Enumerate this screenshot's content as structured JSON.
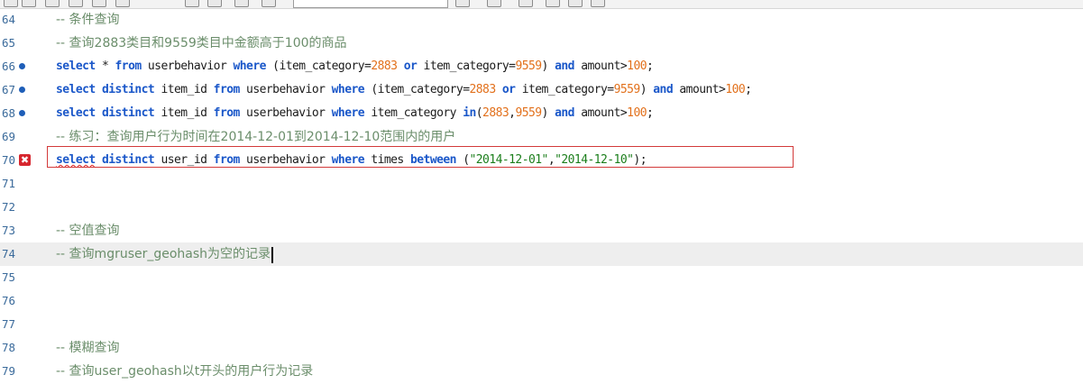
{
  "lines": [
    {
      "no": "64",
      "kind": "comment",
      "text": "-- 条件查询"
    },
    {
      "no": "65",
      "kind": "comment",
      "text": "-- 查询2883类目和9559类目中金额高于100的商品"
    },
    {
      "no": "66",
      "kind": "code",
      "marker": "dot",
      "tokens": [
        {
          "t": "kw",
          "v": "select"
        },
        {
          "t": "id",
          "v": " * "
        },
        {
          "t": "kw",
          "v": "from"
        },
        {
          "t": "id",
          "v": " userbehavior "
        },
        {
          "t": "kw",
          "v": "where"
        },
        {
          "t": "id",
          "v": " (item_category="
        },
        {
          "t": "num",
          "v": "2883"
        },
        {
          "t": "id",
          "v": " "
        },
        {
          "t": "kw",
          "v": "or"
        },
        {
          "t": "id",
          "v": " item_category="
        },
        {
          "t": "num",
          "v": "9559"
        },
        {
          "t": "id",
          "v": ") "
        },
        {
          "t": "kw",
          "v": "and"
        },
        {
          "t": "id",
          "v": " amount>"
        },
        {
          "t": "num",
          "v": "100"
        },
        {
          "t": "id",
          "v": ";"
        }
      ]
    },
    {
      "no": "67",
      "kind": "code",
      "marker": "dot",
      "tokens": [
        {
          "t": "kw",
          "v": "select"
        },
        {
          "t": "id",
          "v": " "
        },
        {
          "t": "kw",
          "v": "distinct"
        },
        {
          "t": "id",
          "v": " item_id "
        },
        {
          "t": "kw",
          "v": "from"
        },
        {
          "t": "id",
          "v": " userbehavior "
        },
        {
          "t": "kw",
          "v": "where"
        },
        {
          "t": "id",
          "v": " (item_category="
        },
        {
          "t": "num",
          "v": "2883"
        },
        {
          "t": "id",
          "v": " "
        },
        {
          "t": "kw",
          "v": "or"
        },
        {
          "t": "id",
          "v": " item_category="
        },
        {
          "t": "num",
          "v": "9559"
        },
        {
          "t": "id",
          "v": ") "
        },
        {
          "t": "kw",
          "v": "and"
        },
        {
          "t": "id",
          "v": " amount>"
        },
        {
          "t": "num",
          "v": "100"
        },
        {
          "t": "id",
          "v": ";"
        }
      ]
    },
    {
      "no": "68",
      "kind": "code",
      "marker": "dot",
      "tokens": [
        {
          "t": "kw",
          "v": "select"
        },
        {
          "t": "id",
          "v": " "
        },
        {
          "t": "kw",
          "v": "distinct"
        },
        {
          "t": "id",
          "v": " item_id "
        },
        {
          "t": "kw",
          "v": "from"
        },
        {
          "t": "id",
          "v": " userbehavior "
        },
        {
          "t": "kw",
          "v": "where"
        },
        {
          "t": "id",
          "v": " item_category "
        },
        {
          "t": "kw",
          "v": "in"
        },
        {
          "t": "id",
          "v": "("
        },
        {
          "t": "num",
          "v": "2883"
        },
        {
          "t": "id",
          "v": ","
        },
        {
          "t": "num",
          "v": "9559"
        },
        {
          "t": "id",
          "v": ") "
        },
        {
          "t": "kw",
          "v": "and"
        },
        {
          "t": "id",
          "v": " amount>"
        },
        {
          "t": "num",
          "v": "100"
        },
        {
          "t": "id",
          "v": ";"
        }
      ]
    },
    {
      "no": "69",
      "kind": "comment",
      "text": "-- 练习：查询用户行为时间在2014-12-01到2014-12-10范围内的用户"
    },
    {
      "no": "70",
      "kind": "code",
      "marker": "error",
      "error": true,
      "tokens": [
        {
          "t": "kw",
          "v": "select",
          "squiggle": true
        },
        {
          "t": "id",
          "v": " "
        },
        {
          "t": "kw",
          "v": "distinct"
        },
        {
          "t": "id",
          "v": " user_id "
        },
        {
          "t": "kw",
          "v": "from"
        },
        {
          "t": "id",
          "v": " userbehavior "
        },
        {
          "t": "kw",
          "v": "where"
        },
        {
          "t": "id",
          "v": " times "
        },
        {
          "t": "kw",
          "v": "between"
        },
        {
          "t": "id",
          "v": " ("
        },
        {
          "t": "str",
          "v": "\"2014-12-01\""
        },
        {
          "t": "id",
          "v": ","
        },
        {
          "t": "str",
          "v": "\"2014-12-10\""
        },
        {
          "t": "id",
          "v": ");"
        }
      ]
    },
    {
      "no": "71",
      "kind": "blank"
    },
    {
      "no": "72",
      "kind": "blank"
    },
    {
      "no": "73",
      "kind": "comment",
      "text": "-- 空值查询"
    },
    {
      "no": "74",
      "kind": "comment",
      "text": "-- 查询mgruser_geohash为空的记录",
      "current": true
    },
    {
      "no": "75",
      "kind": "blank"
    },
    {
      "no": "76",
      "kind": "blank"
    },
    {
      "no": "77",
      "kind": "blank"
    },
    {
      "no": "78",
      "kind": "comment",
      "text": "-- 模糊查询"
    },
    {
      "no": "79",
      "kind": "comment",
      "text": "-- 查询user_geohash以t开头的用户行为记录"
    }
  ],
  "error_marker_label": "✖"
}
